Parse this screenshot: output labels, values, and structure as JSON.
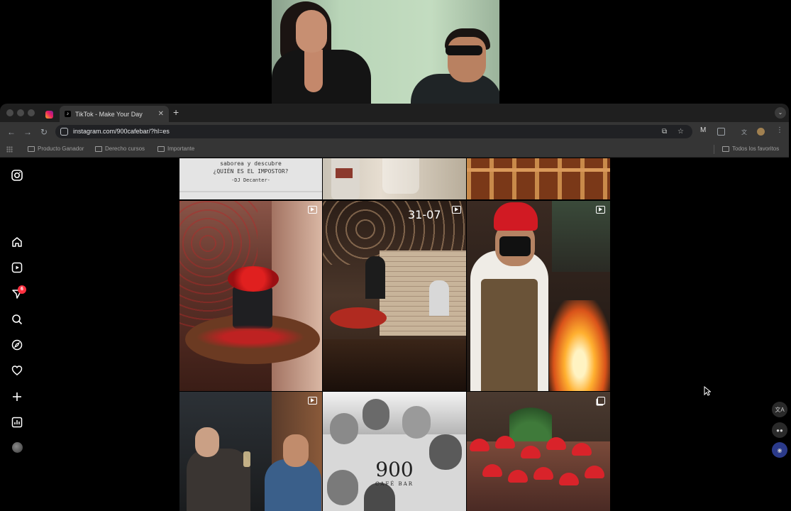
{
  "browser": {
    "tabs": [
      {
        "title": "TikTok - Make Your Day",
        "favicon": "tiktok-icon",
        "active": true
      }
    ],
    "pinned_tab_favicon": "instagram-icon",
    "url": "instagram.com/900cafebar/?hl=es",
    "bookmarks": [
      "Producto Ganador",
      "Derecho cursos",
      "Importante"
    ],
    "all_bookmarks": "Todos los favoritos"
  },
  "instagram": {
    "sidebar": [
      {
        "name": "instagram-logo-icon"
      },
      {
        "name": "home-icon"
      },
      {
        "name": "reels-icon"
      },
      {
        "name": "messages-icon",
        "badge": "6"
      },
      {
        "name": "search-icon"
      },
      {
        "name": "explore-icon"
      },
      {
        "name": "notifications-icon"
      },
      {
        "name": "create-icon"
      },
      {
        "name": "dashboard-icon"
      },
      {
        "name": "profile-avatar"
      }
    ],
    "posts_top_text": {
      "line1": "saborea y descubre",
      "line2": "¿QUIÉN ES EL IMPOSTOR?",
      "line3": "-DJ Decanter-"
    },
    "post_date": "31-07",
    "logo": {
      "number": "900",
      "sub": "CAFÉ BAR"
    }
  },
  "colors": {
    "chrome_dark": "#1f1f1f",
    "toolbar": "#353535",
    "badge": "#ff3040"
  }
}
